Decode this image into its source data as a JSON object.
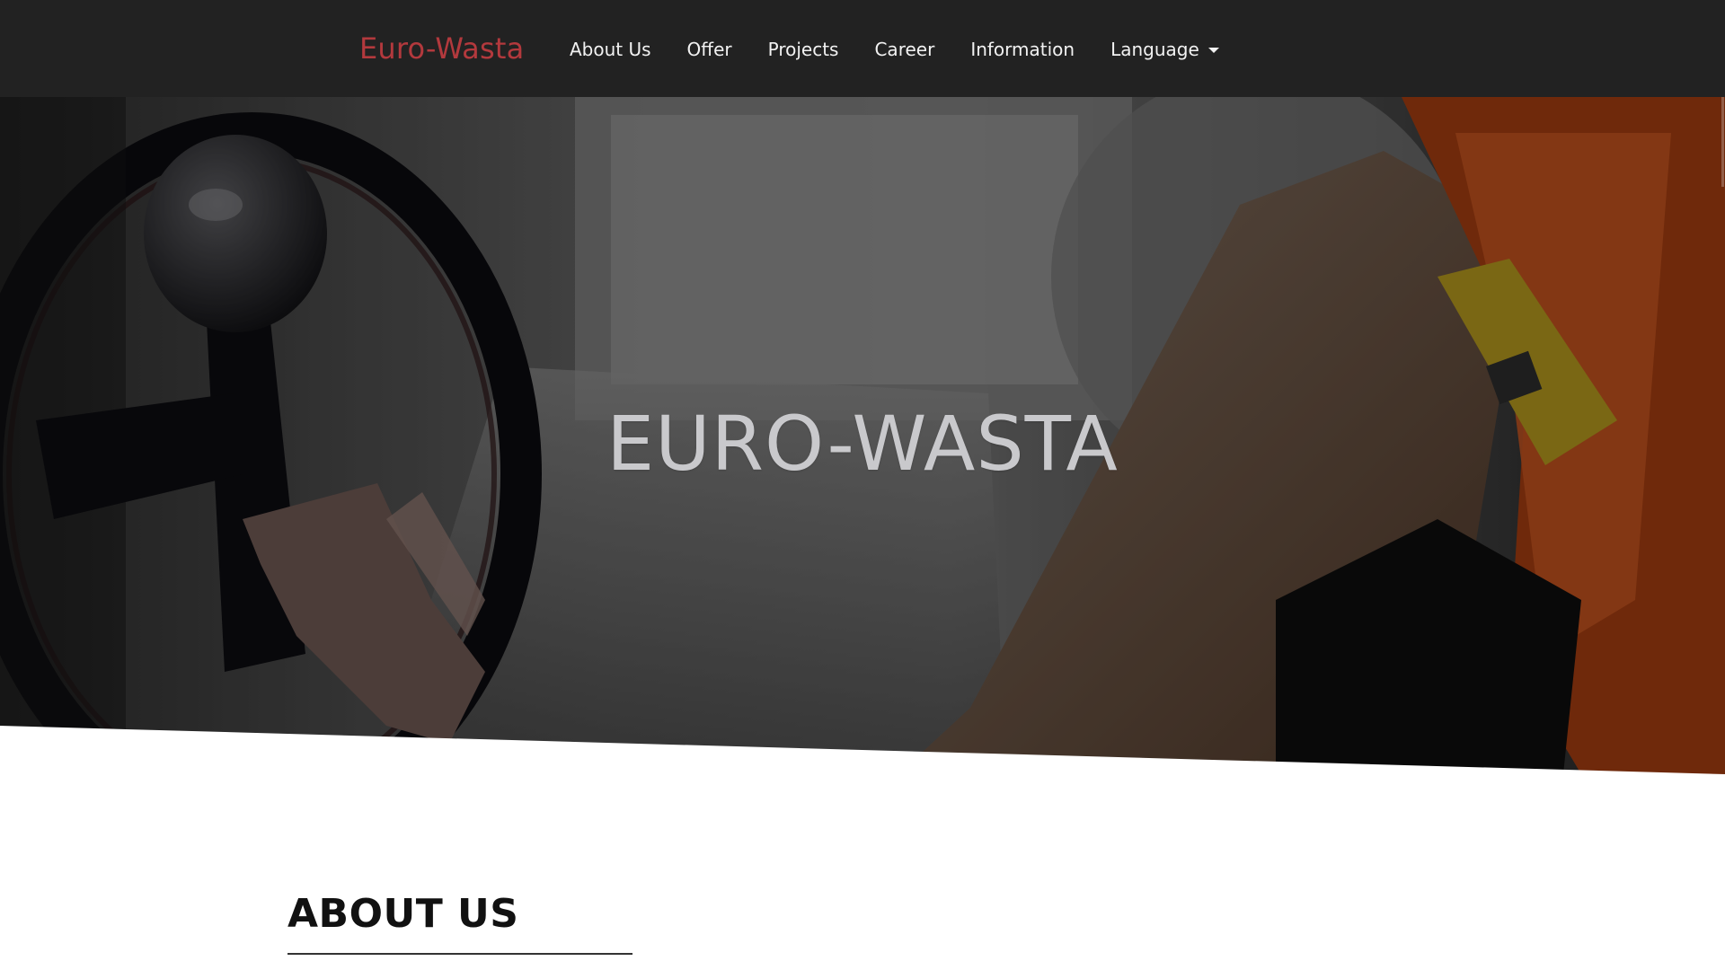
{
  "header": {
    "brand": "Euro-Wasta",
    "nav": {
      "about": "About Us",
      "offer": "Offer",
      "projects": "Projects",
      "career": "Career",
      "information": "Information",
      "language": "Language"
    }
  },
  "hero": {
    "title": "EURO-WASTA"
  },
  "about": {
    "heading": "ABOUT US"
  },
  "colors": {
    "brand": "#b3393d",
    "navbar": "#222222",
    "hero_text": "#c9c9cc"
  }
}
